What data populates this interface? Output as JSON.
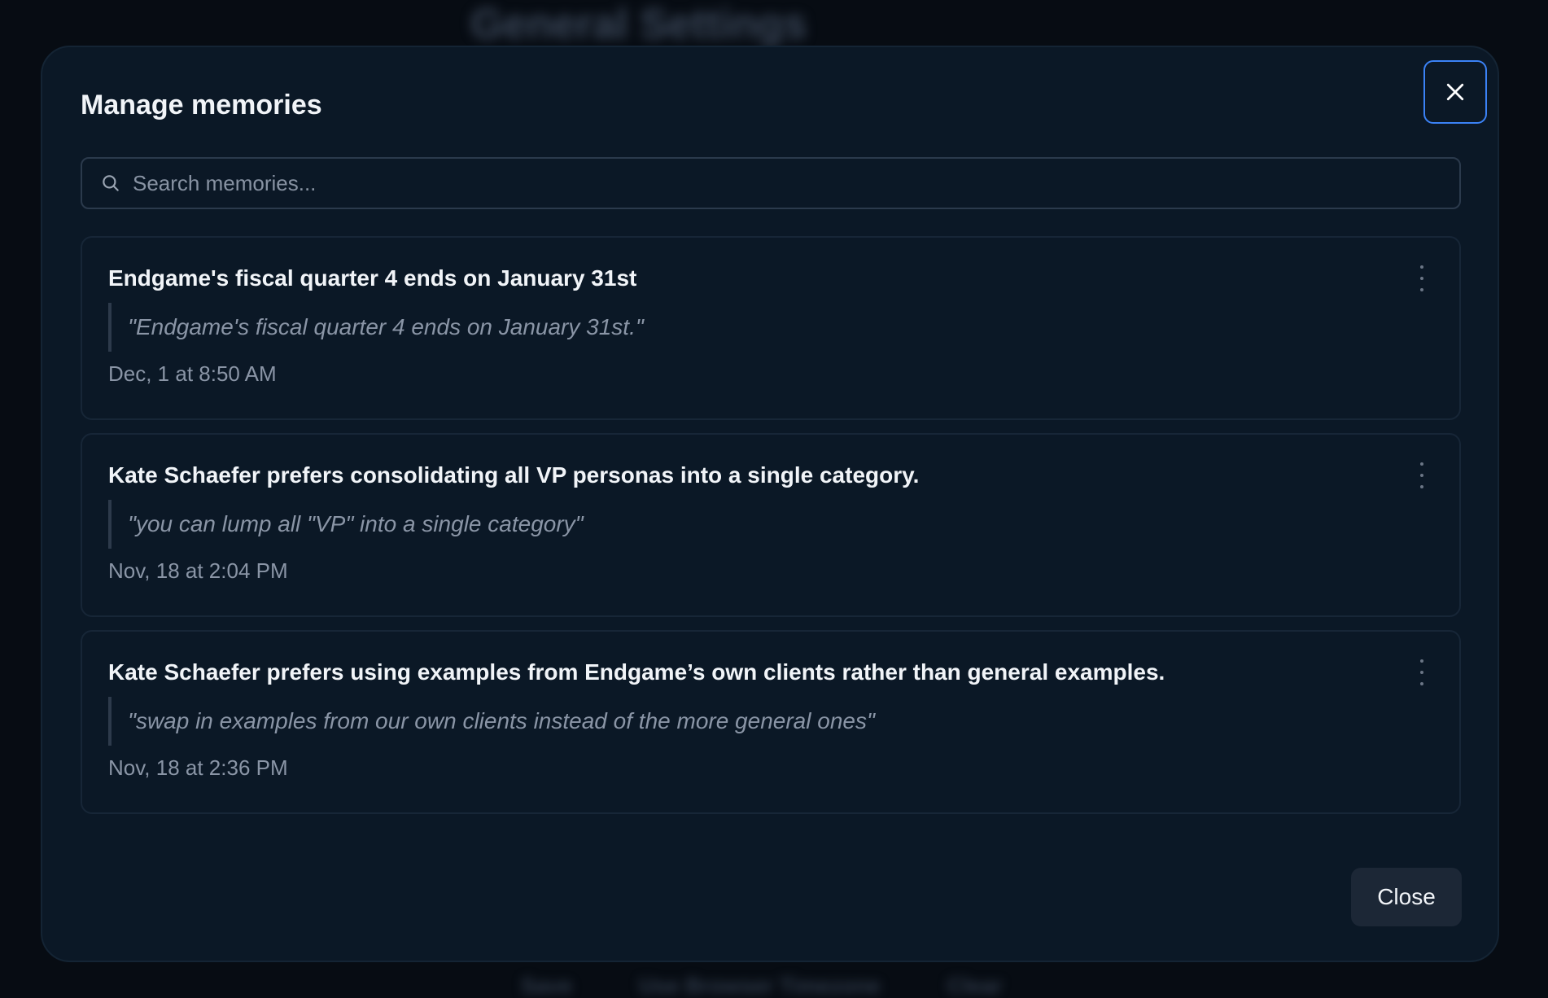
{
  "background": {
    "title": "General Settings",
    "footer": [
      "Save",
      "Use Browser Timezone",
      "Clear"
    ]
  },
  "modal": {
    "title": "Manage memories",
    "search_placeholder": "Search memories...",
    "close_label": "Close"
  },
  "memories": [
    {
      "title": "Endgame's fiscal quarter 4 ends on January 31st",
      "quote": "\"Endgame's fiscal quarter 4 ends on January 31st.\"",
      "date": "Dec, 1 at 8:50 AM"
    },
    {
      "title": "Kate Schaefer prefers consolidating all VP personas into a single category.",
      "quote": "\"you can lump all \"VP\" into a single category\"",
      "date": "Nov, 18 at 2:04 PM"
    },
    {
      "title": "Kate Schaefer prefers using examples from Endgame’s own clients rather than general examples.",
      "quote": "\"swap in examples from our own clients instead of the more general ones\"",
      "date": "Nov, 18 at 2:36 PM"
    }
  ],
  "colors": {
    "accent": "#3b82f6",
    "modal_bg": "#0b1826",
    "backdrop": "#070c13"
  }
}
